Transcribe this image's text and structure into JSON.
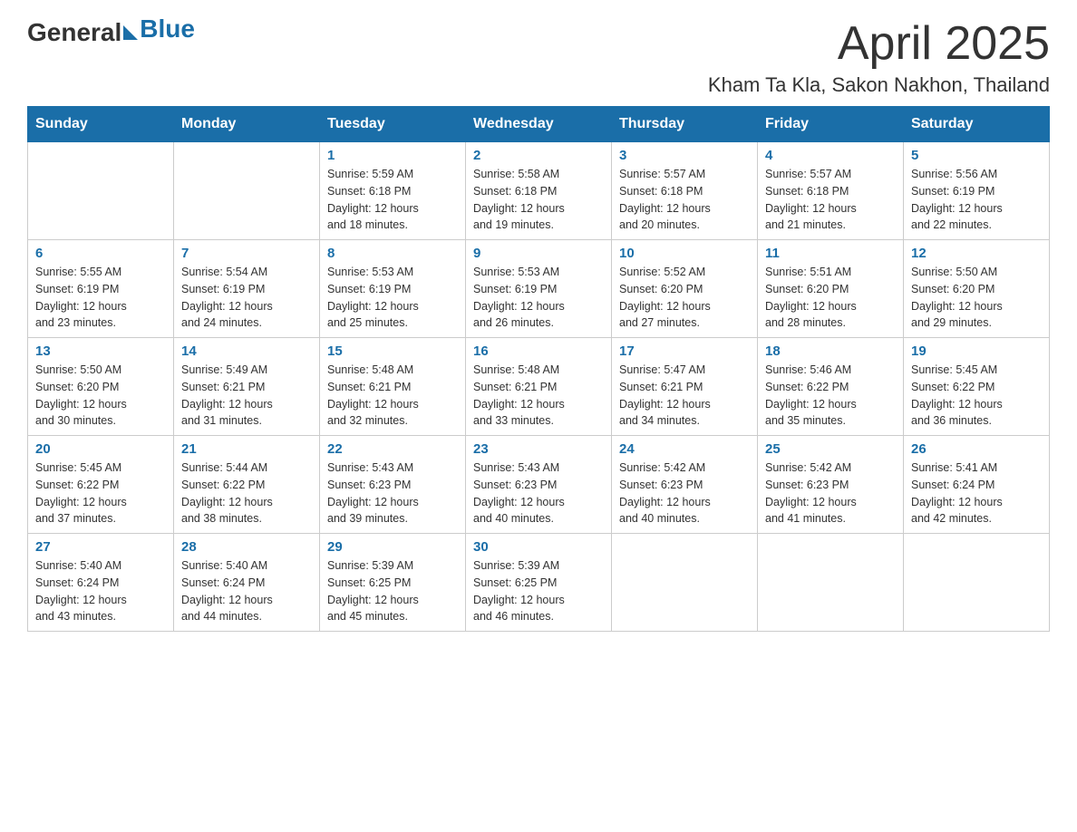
{
  "header": {
    "logo_general": "General",
    "logo_blue": "Blue",
    "month": "April 2025",
    "location": "Kham Ta Kla, Sakon Nakhon, Thailand"
  },
  "weekdays": [
    "Sunday",
    "Monday",
    "Tuesday",
    "Wednesday",
    "Thursday",
    "Friday",
    "Saturday"
  ],
  "weeks": [
    [
      {
        "day": "",
        "info": ""
      },
      {
        "day": "",
        "info": ""
      },
      {
        "day": "1",
        "info": "Sunrise: 5:59 AM\nSunset: 6:18 PM\nDaylight: 12 hours\nand 18 minutes."
      },
      {
        "day": "2",
        "info": "Sunrise: 5:58 AM\nSunset: 6:18 PM\nDaylight: 12 hours\nand 19 minutes."
      },
      {
        "day": "3",
        "info": "Sunrise: 5:57 AM\nSunset: 6:18 PM\nDaylight: 12 hours\nand 20 minutes."
      },
      {
        "day": "4",
        "info": "Sunrise: 5:57 AM\nSunset: 6:18 PM\nDaylight: 12 hours\nand 21 minutes."
      },
      {
        "day": "5",
        "info": "Sunrise: 5:56 AM\nSunset: 6:19 PM\nDaylight: 12 hours\nand 22 minutes."
      }
    ],
    [
      {
        "day": "6",
        "info": "Sunrise: 5:55 AM\nSunset: 6:19 PM\nDaylight: 12 hours\nand 23 minutes."
      },
      {
        "day": "7",
        "info": "Sunrise: 5:54 AM\nSunset: 6:19 PM\nDaylight: 12 hours\nand 24 minutes."
      },
      {
        "day": "8",
        "info": "Sunrise: 5:53 AM\nSunset: 6:19 PM\nDaylight: 12 hours\nand 25 minutes."
      },
      {
        "day": "9",
        "info": "Sunrise: 5:53 AM\nSunset: 6:19 PM\nDaylight: 12 hours\nand 26 minutes."
      },
      {
        "day": "10",
        "info": "Sunrise: 5:52 AM\nSunset: 6:20 PM\nDaylight: 12 hours\nand 27 minutes."
      },
      {
        "day": "11",
        "info": "Sunrise: 5:51 AM\nSunset: 6:20 PM\nDaylight: 12 hours\nand 28 minutes."
      },
      {
        "day": "12",
        "info": "Sunrise: 5:50 AM\nSunset: 6:20 PM\nDaylight: 12 hours\nand 29 minutes."
      }
    ],
    [
      {
        "day": "13",
        "info": "Sunrise: 5:50 AM\nSunset: 6:20 PM\nDaylight: 12 hours\nand 30 minutes."
      },
      {
        "day": "14",
        "info": "Sunrise: 5:49 AM\nSunset: 6:21 PM\nDaylight: 12 hours\nand 31 minutes."
      },
      {
        "day": "15",
        "info": "Sunrise: 5:48 AM\nSunset: 6:21 PM\nDaylight: 12 hours\nand 32 minutes."
      },
      {
        "day": "16",
        "info": "Sunrise: 5:48 AM\nSunset: 6:21 PM\nDaylight: 12 hours\nand 33 minutes."
      },
      {
        "day": "17",
        "info": "Sunrise: 5:47 AM\nSunset: 6:21 PM\nDaylight: 12 hours\nand 34 minutes."
      },
      {
        "day": "18",
        "info": "Sunrise: 5:46 AM\nSunset: 6:22 PM\nDaylight: 12 hours\nand 35 minutes."
      },
      {
        "day": "19",
        "info": "Sunrise: 5:45 AM\nSunset: 6:22 PM\nDaylight: 12 hours\nand 36 minutes."
      }
    ],
    [
      {
        "day": "20",
        "info": "Sunrise: 5:45 AM\nSunset: 6:22 PM\nDaylight: 12 hours\nand 37 minutes."
      },
      {
        "day": "21",
        "info": "Sunrise: 5:44 AM\nSunset: 6:22 PM\nDaylight: 12 hours\nand 38 minutes."
      },
      {
        "day": "22",
        "info": "Sunrise: 5:43 AM\nSunset: 6:23 PM\nDaylight: 12 hours\nand 39 minutes."
      },
      {
        "day": "23",
        "info": "Sunrise: 5:43 AM\nSunset: 6:23 PM\nDaylight: 12 hours\nand 40 minutes."
      },
      {
        "day": "24",
        "info": "Sunrise: 5:42 AM\nSunset: 6:23 PM\nDaylight: 12 hours\nand 40 minutes."
      },
      {
        "day": "25",
        "info": "Sunrise: 5:42 AM\nSunset: 6:23 PM\nDaylight: 12 hours\nand 41 minutes."
      },
      {
        "day": "26",
        "info": "Sunrise: 5:41 AM\nSunset: 6:24 PM\nDaylight: 12 hours\nand 42 minutes."
      }
    ],
    [
      {
        "day": "27",
        "info": "Sunrise: 5:40 AM\nSunset: 6:24 PM\nDaylight: 12 hours\nand 43 minutes."
      },
      {
        "day": "28",
        "info": "Sunrise: 5:40 AM\nSunset: 6:24 PM\nDaylight: 12 hours\nand 44 minutes."
      },
      {
        "day": "29",
        "info": "Sunrise: 5:39 AM\nSunset: 6:25 PM\nDaylight: 12 hours\nand 45 minutes."
      },
      {
        "day": "30",
        "info": "Sunrise: 5:39 AM\nSunset: 6:25 PM\nDaylight: 12 hours\nand 46 minutes."
      },
      {
        "day": "",
        "info": ""
      },
      {
        "day": "",
        "info": ""
      },
      {
        "day": "",
        "info": ""
      }
    ]
  ]
}
